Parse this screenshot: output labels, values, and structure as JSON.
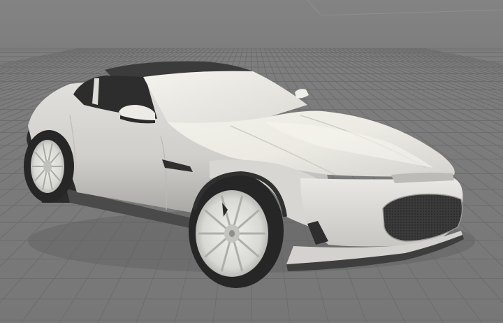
{
  "viewport": {
    "background_color": "#7b7b7b",
    "grid_line_color": "#6c6c6c",
    "grid_minor_color": "#737373",
    "axis_line_color": "#b84a4a",
    "horizon_color": "#838383"
  },
  "model": {
    "body_color": "#e6e5e2",
    "body_shadow_color": "#bdbcb8",
    "body_highlight_color": "#f7f6f0",
    "roof_color": "#3a3a3a",
    "glass_color": "#2e2e2e",
    "tire_color": "#2b2b2b",
    "rim_color": "#dcdcd8",
    "grille_color": "#3c3c3c",
    "lower_trim_color": "#4a4a4a"
  }
}
